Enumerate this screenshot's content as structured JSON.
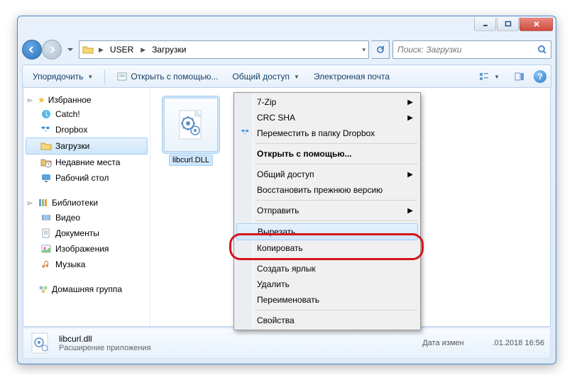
{
  "breadcrumb": {
    "parts": [
      "USER",
      "Загрузки"
    ]
  },
  "search": {
    "placeholder": "Поиск: Загрузки"
  },
  "toolbar": {
    "organize": "Упорядочить",
    "open_with": "Открыть с помощью...",
    "share": "Общий доступ",
    "email": "Электронная почта"
  },
  "sidebar": {
    "favorites": {
      "label": "Избранное",
      "items": [
        "Catch!",
        "Dropbox",
        "Загрузки",
        "Недавние места",
        "Рабочий стол"
      ]
    },
    "libraries": {
      "label": "Библиотеки",
      "items": [
        "Видео",
        "Документы",
        "Изображения",
        "Музыка"
      ]
    },
    "homegroup": {
      "label": "Домашняя группа"
    }
  },
  "file": {
    "name": "libcurl.DLL"
  },
  "details": {
    "name": "libcurl.dll",
    "type": "Расширение приложения",
    "modlabel": "Дата измен",
    "createlabel_tail": ".01.2018 16:56"
  },
  "ctx": {
    "i7zip": "7-Zip",
    "crc": "CRC SHA",
    "dropbox_move": "Переместить в папку Dropbox",
    "open_with": "Открыть с помощью...",
    "share": "Общий доступ",
    "restore": "Восстановить прежнюю версию",
    "send_to": "Отправить",
    "cut": "Вырезать",
    "copy": "Копировать",
    "shortcut": "Создать ярлык",
    "delete": "Удалить",
    "rename": "Переименовать",
    "props": "Свойства"
  }
}
